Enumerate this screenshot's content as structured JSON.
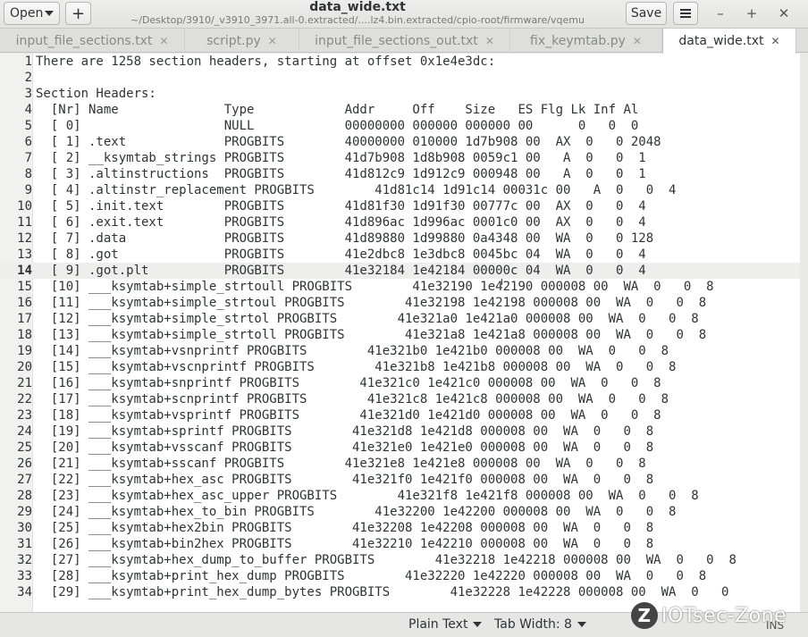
{
  "header": {
    "open_label": "Open",
    "new_tab_label": "+",
    "title": "data_wide.txt",
    "subtitle": "~/Desktop/3910/_v3910_3971.all-0.extracted/....lz4.bin.extracted/cpio-root/firmware/vqemu",
    "save_label": "Save",
    "minimize_glyph": "–",
    "maximize_glyph": "+",
    "close_glyph": "✕"
  },
  "tabs": [
    {
      "label": "input_file_sections.txt",
      "close": "✕"
    },
    {
      "label": "script.py",
      "close": "✕"
    },
    {
      "label": "input_file_sections_out.txt",
      "close": "✕"
    },
    {
      "label": "fix_keymtab.py",
      "close": "✕"
    },
    {
      "label": "data_wide.txt",
      "close": "✕"
    }
  ],
  "editor": {
    "current_line": 14,
    "lines": [
      {
        "n": "1",
        "t": "There are 1258 section headers, starting at offset 0x1e4e3dc:"
      },
      {
        "n": "2",
        "t": ""
      },
      {
        "n": "3",
        "t": "Section Headers:"
      },
      {
        "n": "4",
        "t": "  [Nr] Name              Type            Addr     Off    Size   ES Flg Lk Inf Al"
      },
      {
        "n": "5",
        "t": "  [ 0]                   NULL            00000000 000000 000000 00      0   0  0"
      },
      {
        "n": "6",
        "t": "  [ 1] .text             PROGBITS        40000000 010000 1d7b908 00  AX  0   0 2048"
      },
      {
        "n": "7",
        "t": "  [ 2] __ksymtab_strings PROGBITS        41d7b908 1d8b908 0059c1 00   A  0   0  1"
      },
      {
        "n": "8",
        "t": "  [ 3] .altinstructions  PROGBITS        41d812c9 1d912c9 000948 00   A  0   0  1"
      },
      {
        "n": "9",
        "t": "  [ 4] .altinstr_replacement PROGBITS        41d81c14 1d91c14 00031c 00   A  0   0  4"
      },
      {
        "n": "10",
        "t": "  [ 5] .init.text        PROGBITS        41d81f30 1d91f30 00777c 00  AX  0   0  4"
      },
      {
        "n": "11",
        "t": "  [ 6] .exit.text        PROGBITS        41d896ac 1d996ac 0001c0 00  AX  0   0  4"
      },
      {
        "n": "12",
        "t": "  [ 7] .data             PROGBITS        41d89880 1d99880 0a4348 00  WA  0   0 128"
      },
      {
        "n": "13",
        "t": "  [ 8] .got              PROGBITS        41e2dbc8 1e3dbc8 0045bc 04  WA  0   0  4"
      },
      {
        "n": "14",
        "t": "  [ 9] .got.plt          PROGBITS        41e32184 1e42184 00000c 04  WA  0   0  4"
      },
      {
        "n": "15",
        "t": "  [10] ___ksymtab+simple_strtoull PROGBITS        41e32190 1e42190 000008 00  WA  0   0  8"
      },
      {
        "n": "16",
        "t": "  [11] ___ksymtab+simple_strtoul PROGBITS        41e32198 1e42198 000008 00  WA  0   0  8"
      },
      {
        "n": "17",
        "t": "  [12] ___ksymtab+simple_strtol PROGBITS        41e321a0 1e421a0 000008 00  WA  0   0  8"
      },
      {
        "n": "18",
        "t": "  [13] ___ksymtab+simple_strtoll PROGBITS        41e321a8 1e421a8 000008 00  WA  0   0  8"
      },
      {
        "n": "19",
        "t": "  [14] ___ksymtab+vsnprintf PROGBITS        41e321b0 1e421b0 000008 00  WA  0   0  8"
      },
      {
        "n": "20",
        "t": "  [15] ___ksymtab+vscnprintf PROGBITS        41e321b8 1e421b8 000008 00  WA  0   0  8"
      },
      {
        "n": "21",
        "t": "  [16] ___ksymtab+snprintf PROGBITS        41e321c0 1e421c0 000008 00  WA  0   0  8"
      },
      {
        "n": "22",
        "t": "  [17] ___ksymtab+scnprintf PROGBITS        41e321c8 1e421c8 000008 00  WA  0   0  8"
      },
      {
        "n": "23",
        "t": "  [18] ___ksymtab+vsprintf PROGBITS        41e321d0 1e421d0 000008 00  WA  0   0  8"
      },
      {
        "n": "24",
        "t": "  [19] ___ksymtab+sprintf PROGBITS        41e321d8 1e421d8 000008 00  WA  0   0  8"
      },
      {
        "n": "25",
        "t": "  [20] ___ksymtab+vsscanf PROGBITS        41e321e0 1e421e0 000008 00  WA  0   0  8"
      },
      {
        "n": "26",
        "t": "  [21] ___ksymtab+sscanf PROGBITS        41e321e8 1e421e8 000008 00  WA  0   0  8"
      },
      {
        "n": "27",
        "t": "  [22] ___ksymtab+hex_asc PROGBITS        41e321f0 1e421f0 000008 00  WA  0   0  8"
      },
      {
        "n": "28",
        "t": "  [23] ___ksymtab+hex_asc_upper PROGBITS        41e321f8 1e421f8 000008 00  WA  0   0  8"
      },
      {
        "n": "29",
        "t": "  [24] ___ksymtab+hex_to_bin PROGBITS        41e32200 1e42200 000008 00  WA  0   0  8"
      },
      {
        "n": "30",
        "t": "  [25] ___ksymtab+hex2bin PROGBITS        41e32208 1e42208 000008 00  WA  0   0  8"
      },
      {
        "n": "31",
        "t": "  [26] ___ksymtab+bin2hex PROGBITS        41e32210 1e42210 000008 00  WA  0   0  8"
      },
      {
        "n": "32",
        "t": "  [27] ___ksymtab+hex_dump_to_buffer PROGBITS        41e32218 1e42218 000008 00  WA  0   0  8"
      },
      {
        "n": "33",
        "t": "  [28] ___ksymtab+print_hex_dump PROGBITS        41e32220 1e42220 000008 00  WA  0   0  8"
      },
      {
        "n": "34",
        "t": "  [29] ___ksymtab+print_hex_dump_bytes PROGBITS        41e32228 1e42228 000008 00  WA  0   0"
      }
    ]
  },
  "statusbar": {
    "language": "Plain Text",
    "tab_width": "Tab Width: 8",
    "mode": "INS"
  },
  "watermark": {
    "logo_text": "Z",
    "text": "IOTsec-Zone"
  }
}
